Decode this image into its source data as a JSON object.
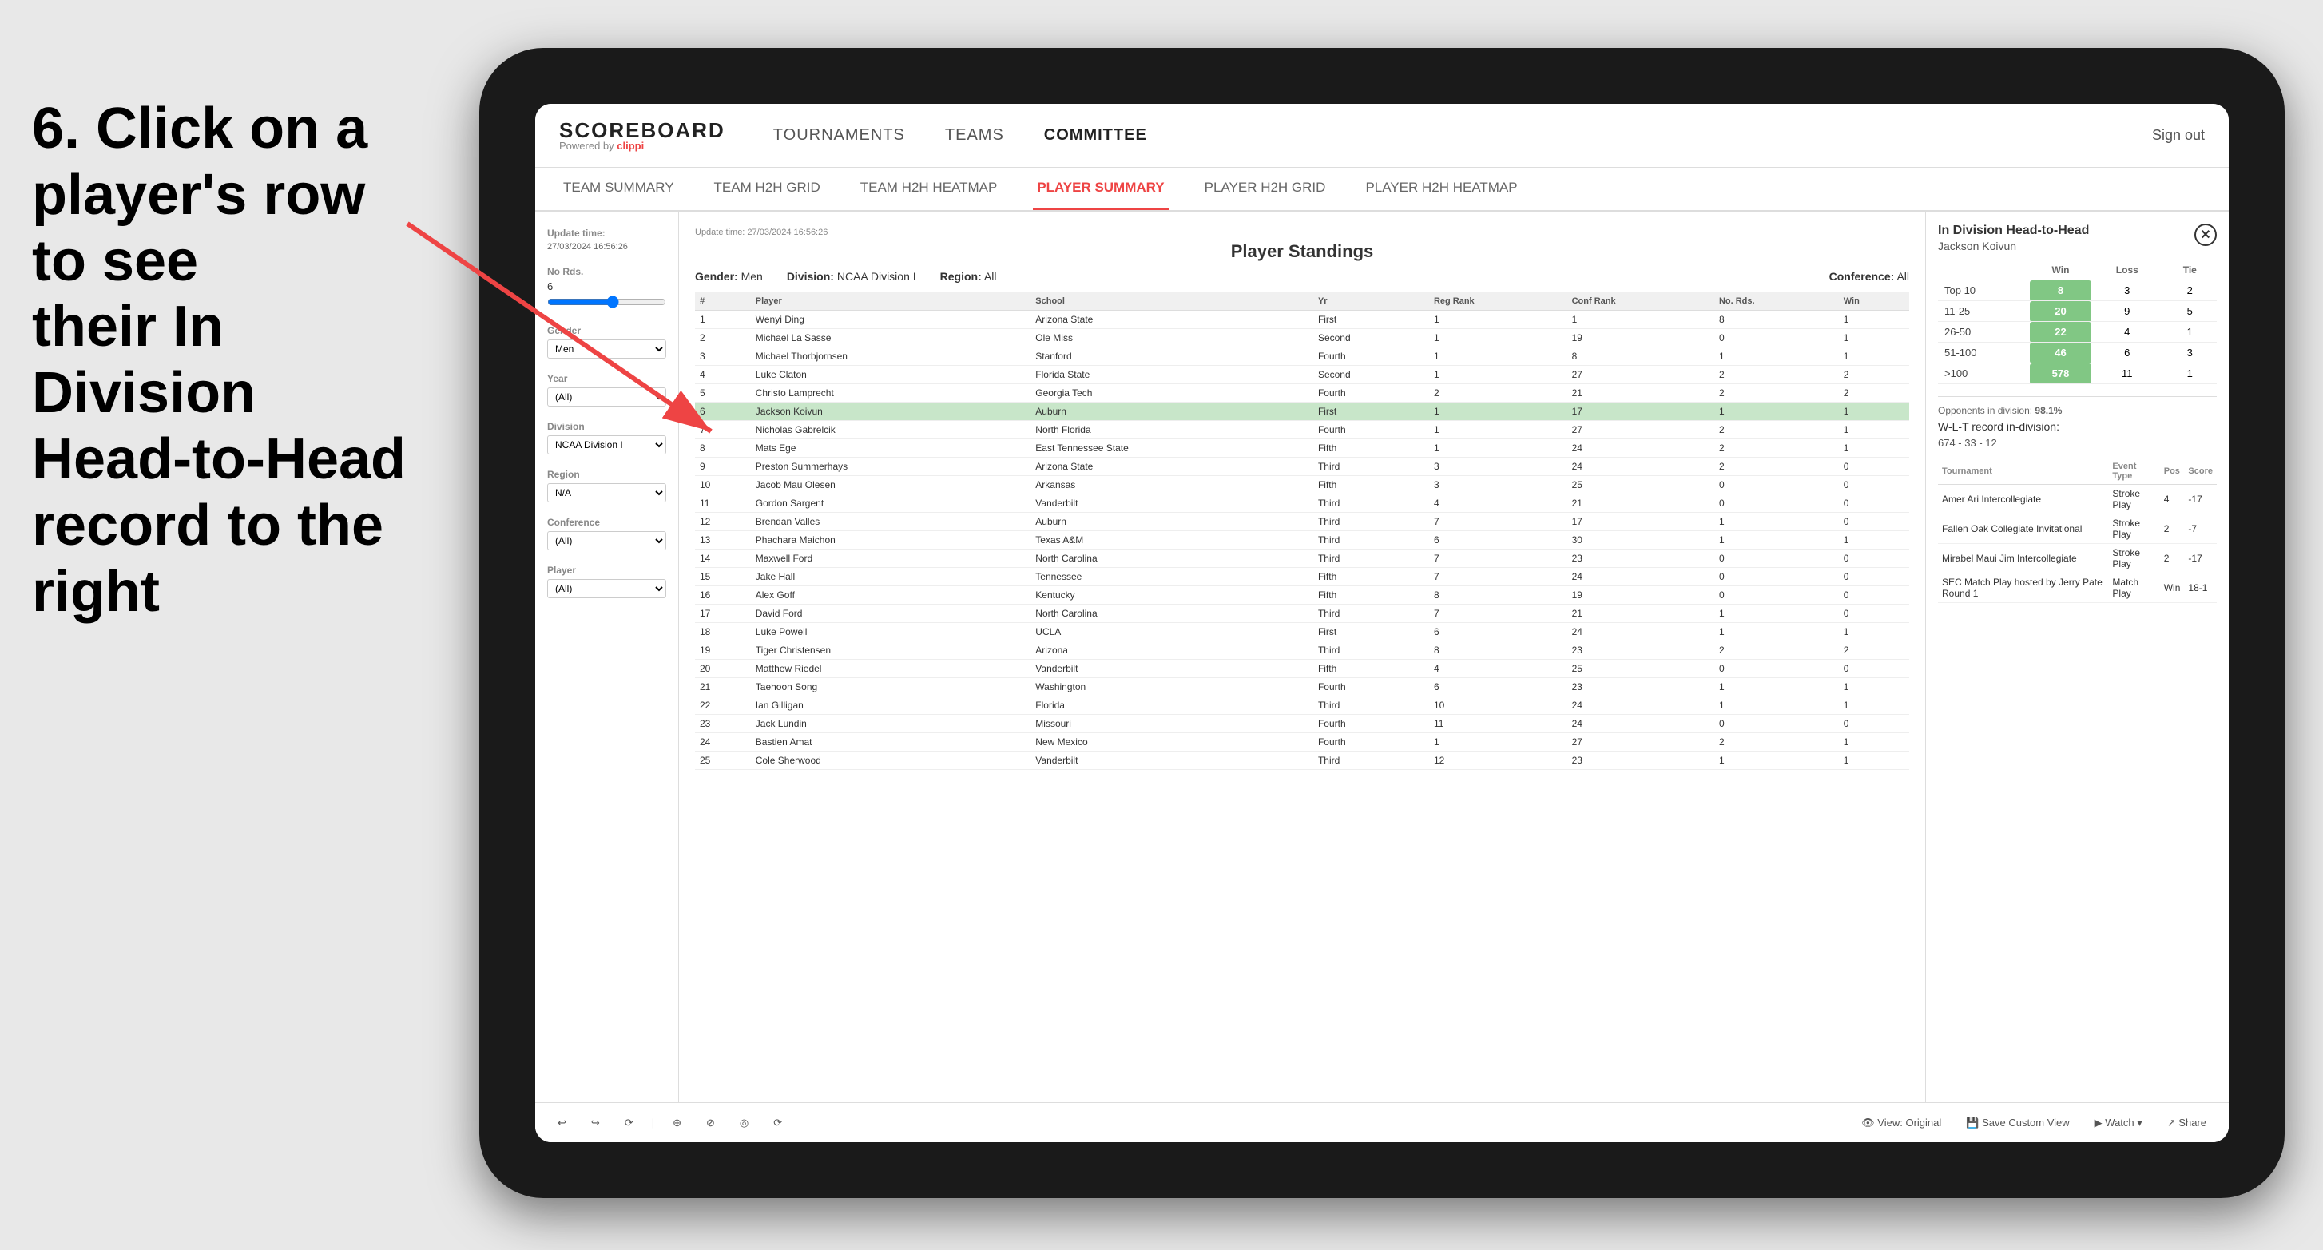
{
  "instruction": {
    "line1": "6. Click on a",
    "line2": "player's row to see",
    "line3": "their In Division",
    "line4": "Head-to-Head",
    "line5": "record to the right"
  },
  "nav": {
    "logo": "SCOREBOARD",
    "logo_sub": "Powered by clippi",
    "items": [
      "TOURNAMENTS",
      "TEAMS",
      "COMMITTEE"
    ],
    "sign_out": "Sign out"
  },
  "sub_nav": {
    "items": [
      "TEAM SUMMARY",
      "TEAM H2H GRID",
      "TEAM H2H HEATMAP",
      "PLAYER SUMMARY",
      "PLAYER H2H GRID",
      "PLAYER H2H HEATMAP"
    ],
    "active": "PLAYER SUMMARY"
  },
  "sidebar": {
    "update_label": "Update time:",
    "update_time": "27/03/2024 16:56:26",
    "no_rds_label": "No Rds.",
    "no_rds_value": "6",
    "gender_label": "Gender",
    "gender_value": "Men",
    "year_label": "Year",
    "year_value": "(All)",
    "division_label": "Division",
    "division_value": "NCAA Division I",
    "region_label": "Region",
    "region_value": "N/A",
    "conference_label": "Conference",
    "conference_value": "(All)",
    "player_label": "Player",
    "player_value": "(All)"
  },
  "panel": {
    "title": "Player Standings",
    "gender": "Men",
    "division": "NCAA Division I",
    "region": "All",
    "conference": "All",
    "columns": [
      "#",
      "Player",
      "School",
      "Yr",
      "Reg Rank",
      "Conf Rank",
      "No. Rds.",
      "Win"
    ],
    "rows": [
      {
        "rank": 1,
        "player": "Wenyi Ding",
        "school": "Arizona State",
        "yr": "First",
        "reg": 1,
        "conf": 1,
        "rds": 8,
        "win": 1
      },
      {
        "rank": 2,
        "player": "Michael La Sasse",
        "school": "Ole Miss",
        "yr": "Second",
        "reg": 1,
        "conf": 19,
        "rds": 0,
        "win": 1
      },
      {
        "rank": 3,
        "player": "Michael Thorbjornsen",
        "school": "Stanford",
        "yr": "Fourth",
        "reg": 1,
        "conf": 8,
        "rds": 1,
        "win": 1
      },
      {
        "rank": 4,
        "player": "Luke Claton",
        "school": "Florida State",
        "yr": "Second",
        "reg": 1,
        "conf": 27,
        "rds": 2,
        "win": 2
      },
      {
        "rank": 5,
        "player": "Christo Lamprecht",
        "school": "Georgia Tech",
        "yr": "Fourth",
        "reg": 2,
        "conf": 21,
        "rds": 2,
        "win": 2
      },
      {
        "rank": 6,
        "player": "Jackson Koivun",
        "school": "Auburn",
        "yr": "First",
        "reg": 1,
        "conf": 17,
        "rds": 1,
        "win": 1,
        "selected": true
      },
      {
        "rank": 7,
        "player": "Nicholas Gabrelcik",
        "school": "North Florida",
        "yr": "Fourth",
        "reg": 1,
        "conf": 27,
        "rds": 2,
        "win": 1
      },
      {
        "rank": 8,
        "player": "Mats Ege",
        "school": "East Tennessee State",
        "yr": "Fifth",
        "reg": 1,
        "conf": 24,
        "rds": 2,
        "win": 1
      },
      {
        "rank": 9,
        "player": "Preston Summerhays",
        "school": "Arizona State",
        "yr": "Third",
        "reg": 3,
        "conf": 24,
        "rds": 2,
        "win": 0
      },
      {
        "rank": 10,
        "player": "Jacob Mau Olesen",
        "school": "Arkansas",
        "yr": "Fifth",
        "reg": 3,
        "conf": 25,
        "rds": 0,
        "win": 0
      },
      {
        "rank": 11,
        "player": "Gordon Sargent",
        "school": "Vanderbilt",
        "yr": "Third",
        "reg": 4,
        "conf": 21,
        "rds": 0,
        "win": 0
      },
      {
        "rank": 12,
        "player": "Brendan Valles",
        "school": "Auburn",
        "yr": "Third",
        "reg": 7,
        "conf": 17,
        "rds": 1,
        "win": 0
      },
      {
        "rank": 13,
        "player": "Phachara Maichon",
        "school": "Texas A&M",
        "yr": "Third",
        "reg": 6,
        "conf": 30,
        "rds": 1,
        "win": 1
      },
      {
        "rank": 14,
        "player": "Maxwell Ford",
        "school": "North Carolina",
        "yr": "Third",
        "reg": 7,
        "conf": 23,
        "rds": 0,
        "win": 0
      },
      {
        "rank": 15,
        "player": "Jake Hall",
        "school": "Tennessee",
        "yr": "Fifth",
        "reg": 7,
        "conf": 24,
        "rds": 0,
        "win": 0
      },
      {
        "rank": 16,
        "player": "Alex Goff",
        "school": "Kentucky",
        "yr": "Fifth",
        "reg": 8,
        "conf": 19,
        "rds": 0,
        "win": 0
      },
      {
        "rank": 17,
        "player": "David Ford",
        "school": "North Carolina",
        "yr": "Third",
        "reg": 7,
        "conf": 21,
        "rds": 1,
        "win": 0
      },
      {
        "rank": 18,
        "player": "Luke Powell",
        "school": "UCLA",
        "yr": "First",
        "reg": 6,
        "conf": 24,
        "rds": 1,
        "win": 1
      },
      {
        "rank": 19,
        "player": "Tiger Christensen",
        "school": "Arizona",
        "yr": "Third",
        "reg": 8,
        "conf": 23,
        "rds": 2,
        "win": 2
      },
      {
        "rank": 20,
        "player": "Matthew Riedel",
        "school": "Vanderbilt",
        "yr": "Fifth",
        "reg": 4,
        "conf": 25,
        "rds": 0,
        "win": 0
      },
      {
        "rank": 21,
        "player": "Taehoon Song",
        "school": "Washington",
        "yr": "Fourth",
        "reg": 6,
        "conf": 23,
        "rds": 1,
        "win": 1
      },
      {
        "rank": 22,
        "player": "Ian Gilligan",
        "school": "Florida",
        "yr": "Third",
        "reg": 10,
        "conf": 24,
        "rds": 1,
        "win": 1
      },
      {
        "rank": 23,
        "player": "Jack Lundin",
        "school": "Missouri",
        "yr": "Fourth",
        "reg": 11,
        "conf": 24,
        "rds": 0,
        "win": 0
      },
      {
        "rank": 24,
        "player": "Bastien Amat",
        "school": "New Mexico",
        "yr": "Fourth",
        "reg": 1,
        "conf": 27,
        "rds": 2,
        "win": 1
      },
      {
        "rank": 25,
        "player": "Cole Sherwood",
        "school": "Vanderbilt",
        "yr": "Third",
        "reg": 12,
        "conf": 23,
        "rds": 1,
        "win": 1
      }
    ]
  },
  "h2h": {
    "title": "In Division Head-to-Head",
    "player": "Jackson Koivun",
    "columns": [
      "",
      "Win",
      "Loss",
      "Tie"
    ],
    "rows": [
      {
        "rank": "Top 10",
        "win": 8,
        "loss": 3,
        "tie": 2
      },
      {
        "rank": "11-25",
        "win": 20,
        "loss": 9,
        "tie": 5
      },
      {
        "rank": "26-50",
        "win": 22,
        "loss": 4,
        "tie": 1
      },
      {
        "rank": "51-100",
        "win": 46,
        "loss": 6,
        "tie": 3
      },
      {
        "rank": ">100",
        "win": 578,
        "loss": 11,
        "tie": 1
      }
    ],
    "opponents_label": "Opponents in division:",
    "opponents_value": "98.1%",
    "wlt_label": "W-L-T record in-division:",
    "wlt_value": "674 - 33 - 12",
    "tournament_columns": [
      "Tournament",
      "Event Type",
      "Pos",
      "Score"
    ],
    "tournaments": [
      {
        "name": "Amer Ari Intercollegiate",
        "type": "Stroke Play",
        "pos": 4,
        "score": "-17"
      },
      {
        "name": "Fallen Oak Collegiate Invitational",
        "type": "Stroke Play",
        "pos": 2,
        "score": "-7"
      },
      {
        "name": "Mirabel Maui Jim Intercollegiate",
        "type": "Stroke Play",
        "pos": 2,
        "score": "-17"
      },
      {
        "name": "SEC Match Play hosted by Jerry Pate Round 1",
        "type": "Match Play",
        "pos": "Win",
        "score": "18-1"
      }
    ]
  },
  "toolbar": {
    "buttons": [
      "↩",
      "↪",
      "⟳",
      "⊕",
      "⊘",
      "◎",
      "⟳"
    ],
    "view_original": "View: Original",
    "save_custom": "Save Custom View",
    "watch": "Watch",
    "share": "Share"
  }
}
